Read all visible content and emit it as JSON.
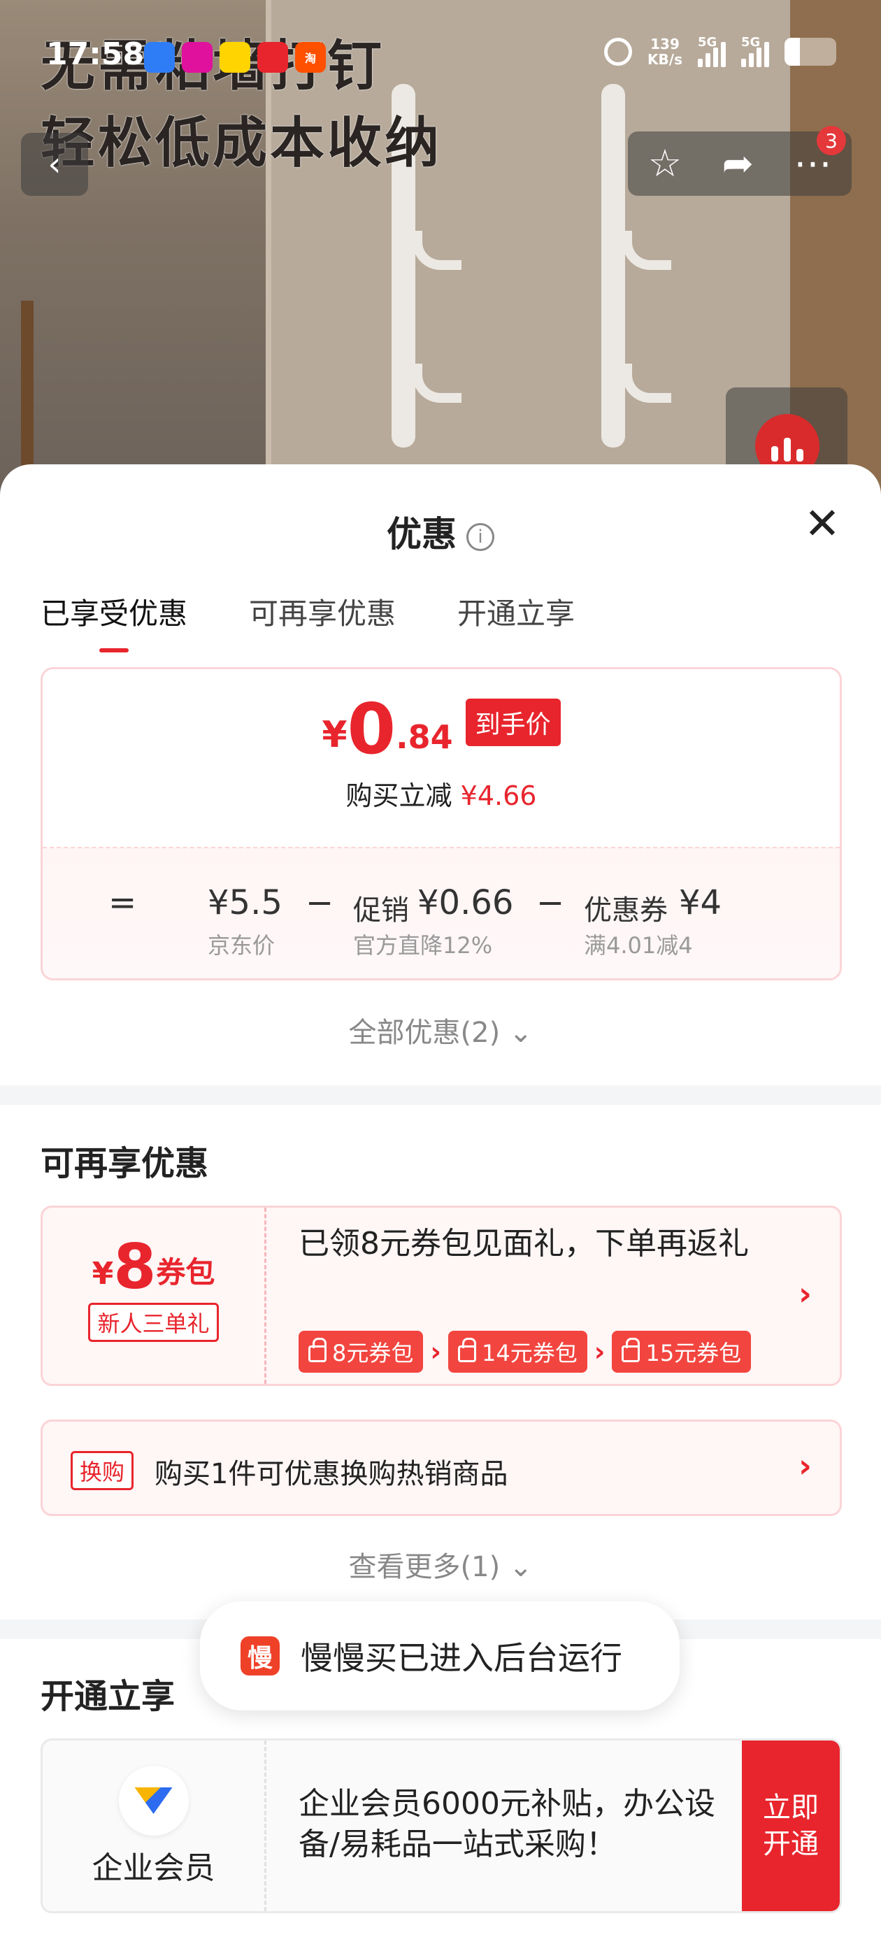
{
  "status_bar": {
    "time": "17:58",
    "apps": [
      {
        "icon": "blue-app-icon",
        "label": "",
        "color": "#2f7df6"
      },
      {
        "icon": "pink-app-icon",
        "label": "",
        "color": "#e0119d"
      },
      {
        "icon": "yellow-app-icon",
        "label": "",
        "color": "#ffd400"
      },
      {
        "icon": "red-app-icon",
        "label": "",
        "color": "#e8252d"
      },
      {
        "icon": "taobao-icon",
        "label": "淘",
        "color": "#ff5000"
      }
    ],
    "net_speed_value": "139",
    "net_speed_unit": "KB/s",
    "signal1_label": "5G",
    "signal2_label": "5G"
  },
  "hero": {
    "line1": "无需粘墙打钉",
    "line2": "轻松低成本收纳",
    "cart_badge": "3"
  },
  "sheet": {
    "title": "优惠",
    "info_symbol": "i",
    "close_symbol": "✕",
    "tabs": [
      {
        "label": "已享受优惠",
        "active": true
      },
      {
        "label": "可再享优惠",
        "active": false
      },
      {
        "label": "开通立享",
        "active": false
      }
    ],
    "price": {
      "currency": "¥",
      "integer": "0",
      "decimal": ".84",
      "tag": "到手价",
      "cut_label": "购买立减",
      "cut_value": "¥4.66"
    },
    "formula": {
      "equals": "=",
      "jd_price": "¥5.5",
      "jd_label": "京东价",
      "minus1": "−",
      "promo_label": "促销",
      "promo_value": "¥0.66",
      "promo_sub": "官方直降12%",
      "minus2": "−",
      "coupon_label": "优惠券",
      "coupon_value": "¥4",
      "coupon_sub": "满4.01减4"
    },
    "all_offers": "全部优惠(2)",
    "section_more": {
      "title": "可再享优惠",
      "coupon": {
        "currency": "¥",
        "amount": "8",
        "unit": "券包",
        "sub": "新人三单礼",
        "text": "已领8元券包见面礼，下单再返礼",
        "chips": [
          "8元券包",
          "14元券包",
          "15元券包"
        ]
      },
      "swap": {
        "tag": "换购",
        "text": "购买1件可优惠换购热销商品"
      },
      "see_more": "查看更多(1)"
    },
    "section_open": {
      "title": "开通立享",
      "member": {
        "name": "企业会员",
        "text": "企业会员6000元补贴，办公设备/易耗品一站式采购！",
        "button": "立即开通"
      }
    }
  },
  "toast": {
    "icon_text": "慢",
    "text": "慢慢买已进入后台运行"
  }
}
